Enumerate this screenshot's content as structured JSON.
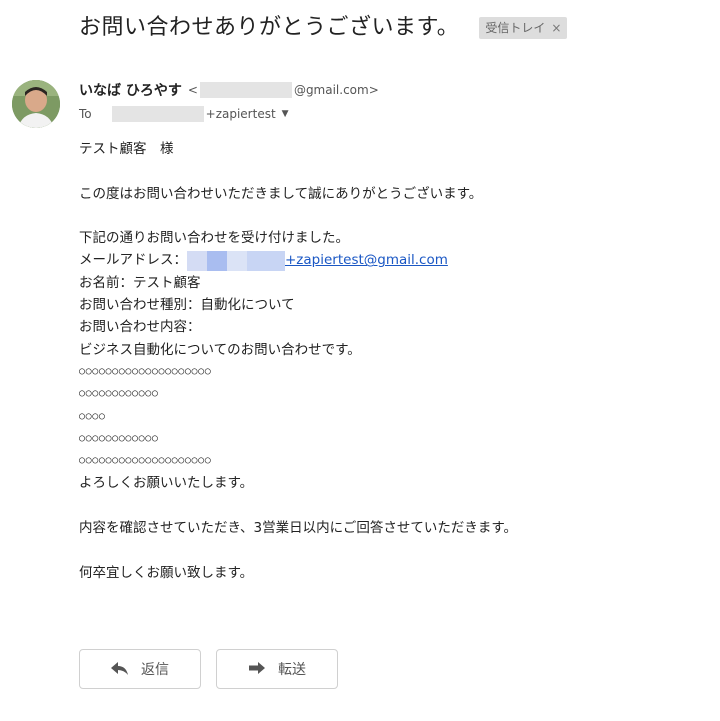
{
  "subject": "お問い合わせありがとうございます。",
  "label": {
    "text": "受信トレイ",
    "close": "×"
  },
  "sender": {
    "name": "いなば ひろやす",
    "email_prefix": "<",
    "email_suffix": "@gmail.com>"
  },
  "recipient": {
    "to_label": "To",
    "address_suffix": "+zapiertest"
  },
  "body": {
    "greeting": "テスト顧客　様",
    "thanks": "この度はお問い合わせいただきまして誠にありがとうございます。",
    "received": "下記の通りお問い合わせを受け付けました。",
    "email_label": "メールアドレス：",
    "email_value": "+zapiertest@gmail.com",
    "name_line": "お名前：テスト顧客",
    "type_line": "お問い合わせ種別：自動化について",
    "content_label": "お問い合わせ内容：",
    "content_line": "ビジネス自動化についてのお問い合わせです。",
    "circle_lines": [
      "○○○○○○○○○○○○○○○○○○○○",
      "○○○○○○○○○○○○",
      "○○○○",
      "○○○○○○○○○○○○",
      "○○○○○○○○○○○○○○○○○○○○"
    ],
    "regards": "よろしくお願いいたします。",
    "reply_notice": "内容を確認させていただき、3営業日以内にご回答させていただきます。",
    "closing": "何卒宜しくお願い致します。"
  },
  "actions": {
    "reply": "返信",
    "forward": "転送"
  },
  "icons": {
    "reply": "reply-arrow-icon",
    "forward": "forward-arrow-icon",
    "dropdown": "caret-down-icon"
  }
}
